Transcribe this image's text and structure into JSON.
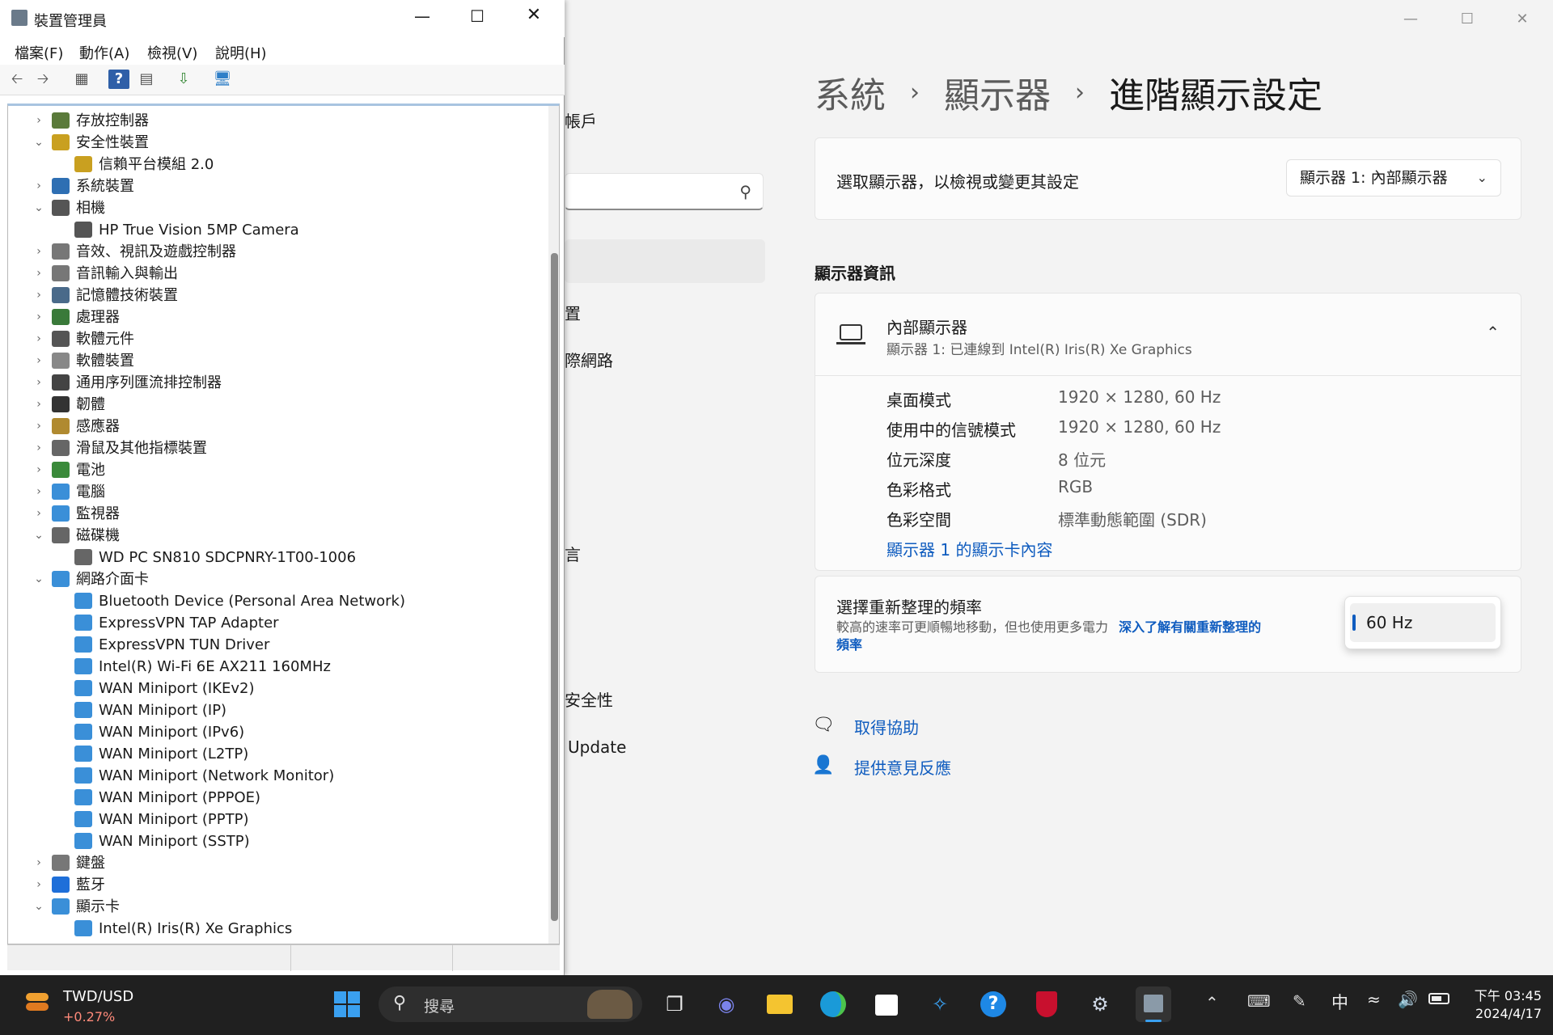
{
  "settings": {
    "breadcrumb": [
      "系統",
      "顯示器",
      "進階顯示設定"
    ],
    "select_card": {
      "label": "選取顯示器，以檢視或變更其設定",
      "dropdown_value": "顯示器 1: 內部顯示器"
    },
    "section_title": "顯示器資訊",
    "monitor": {
      "name": "內部顯示器",
      "sub": "顯示器 1: 已連線到 Intel(R) Iris(R) Xe Graphics",
      "rows": [
        {
          "k": "桌面模式",
          "v": "1920 × 1280, 60 Hz"
        },
        {
          "k": "使用中的信號模式",
          "v": "1920 × 1280, 60 Hz"
        },
        {
          "k": "位元深度",
          "v": "8 位元"
        },
        {
          "k": "色彩格式",
          "v": "RGB"
        },
        {
          "k": "色彩空間",
          "v": "標準動態範圍 (SDR)"
        }
      ],
      "link": "顯示器 1 的顯示卡內容"
    },
    "refresh": {
      "title": "選擇重新整理的頻率",
      "desc": "較高的速率可更順暢地移動，但也使用更多電力",
      "link1": "深入了解有關重新整理的",
      "link2": "頻率",
      "value": "60 Hz"
    },
    "help": [
      "取得協助",
      "提供意見反應"
    ],
    "left_fragments": [
      "帳戶",
      "置",
      "際網路",
      "言",
      "安全性",
      "Update"
    ]
  },
  "devmgr": {
    "title": "裝置管理員",
    "menu": [
      "檔案(F)",
      "動作(A)",
      "檢視(V)",
      "說明(H)"
    ],
    "tree": [
      {
        "label": "存放控制器",
        "level": 0,
        "exp": "collapsed",
        "color": "#5a7a3a"
      },
      {
        "label": "安全性裝置",
        "level": 0,
        "exp": "expanded",
        "color": "#c9a020"
      },
      {
        "label": "信賴平台模組 2.0",
        "level": 1,
        "exp": "none",
        "color": "#c9a020"
      },
      {
        "label": "系統裝置",
        "level": 0,
        "exp": "collapsed",
        "color": "#2e6fb3"
      },
      {
        "label": "相機",
        "level": 0,
        "exp": "expanded",
        "color": "#555555"
      },
      {
        "label": "HP True Vision 5MP Camera",
        "level": 1,
        "exp": "none",
        "color": "#555555"
      },
      {
        "label": "音效、視訊及遊戲控制器",
        "level": 0,
        "exp": "collapsed",
        "color": "#777777"
      },
      {
        "label": "音訊輸入與輸出",
        "level": 0,
        "exp": "collapsed",
        "color": "#777777"
      },
      {
        "label": "記憶體技術裝置",
        "level": 0,
        "exp": "collapsed",
        "color": "#4a6a8a"
      },
      {
        "label": "處理器",
        "level": 0,
        "exp": "collapsed",
        "color": "#3a7a3a"
      },
      {
        "label": "軟體元件",
        "level": 0,
        "exp": "collapsed",
        "color": "#555555"
      },
      {
        "label": "軟體裝置",
        "level": 0,
        "exp": "collapsed",
        "color": "#888888"
      },
      {
        "label": "通用序列匯流排控制器",
        "level": 0,
        "exp": "collapsed",
        "color": "#444444"
      },
      {
        "label": "韌體",
        "level": 0,
        "exp": "collapsed",
        "color": "#333333"
      },
      {
        "label": "感應器",
        "level": 0,
        "exp": "collapsed",
        "color": "#b08a30"
      },
      {
        "label": "滑鼠及其他指標裝置",
        "level": 0,
        "exp": "collapsed",
        "color": "#666666"
      },
      {
        "label": "電池",
        "level": 0,
        "exp": "collapsed",
        "color": "#3a8a3a"
      },
      {
        "label": "電腦",
        "level": 0,
        "exp": "collapsed",
        "color": "#3a8fd8"
      },
      {
        "label": "監視器",
        "level": 0,
        "exp": "collapsed",
        "color": "#3a8fd8"
      },
      {
        "label": "磁碟機",
        "level": 0,
        "exp": "expanded",
        "color": "#666666"
      },
      {
        "label": "WD PC SN810 SDCPNRY-1T00-1006",
        "level": 1,
        "exp": "none",
        "color": "#666666"
      },
      {
        "label": "網路介面卡",
        "level": 0,
        "exp": "expanded",
        "color": "#3a8fd8"
      },
      {
        "label": "Bluetooth Device (Personal Area Network)",
        "level": 1,
        "exp": "none",
        "color": "#3a8fd8"
      },
      {
        "label": "ExpressVPN TAP Adapter",
        "level": 1,
        "exp": "none",
        "color": "#3a8fd8"
      },
      {
        "label": "ExpressVPN TUN Driver",
        "level": 1,
        "exp": "none",
        "color": "#3a8fd8"
      },
      {
        "label": "Intel(R) Wi-Fi 6E AX211 160MHz",
        "level": 1,
        "exp": "none",
        "color": "#3a8fd8"
      },
      {
        "label": "WAN Miniport (IKEv2)",
        "level": 1,
        "exp": "none",
        "color": "#3a8fd8"
      },
      {
        "label": "WAN Miniport (IP)",
        "level": 1,
        "exp": "none",
        "color": "#3a8fd8"
      },
      {
        "label": "WAN Miniport (IPv6)",
        "level": 1,
        "exp": "none",
        "color": "#3a8fd8"
      },
      {
        "label": "WAN Miniport (L2TP)",
        "level": 1,
        "exp": "none",
        "color": "#3a8fd8"
      },
      {
        "label": "WAN Miniport (Network Monitor)",
        "level": 1,
        "exp": "none",
        "color": "#3a8fd8"
      },
      {
        "label": "WAN Miniport (PPPOE)",
        "level": 1,
        "exp": "none",
        "color": "#3a8fd8"
      },
      {
        "label": "WAN Miniport (PPTP)",
        "level": 1,
        "exp": "none",
        "color": "#3a8fd8"
      },
      {
        "label": "WAN Miniport (SSTP)",
        "level": 1,
        "exp": "none",
        "color": "#3a8fd8"
      },
      {
        "label": "鍵盤",
        "level": 0,
        "exp": "collapsed",
        "color": "#777777"
      },
      {
        "label": "藍牙",
        "level": 0,
        "exp": "collapsed",
        "color": "#1e6fd9"
      },
      {
        "label": "顯示卡",
        "level": 0,
        "exp": "expanded",
        "color": "#3a8fd8"
      },
      {
        "label": "Intel(R) Iris(R) Xe Graphics",
        "level": 1,
        "exp": "none",
        "color": "#3a8fd8"
      }
    ]
  },
  "taskbar": {
    "ticker": "TWD/USD",
    "change": "+0.27%",
    "search_placeholder": "搜尋",
    "ime": "中",
    "time": "下午 03:45",
    "date": "2024/4/17"
  }
}
